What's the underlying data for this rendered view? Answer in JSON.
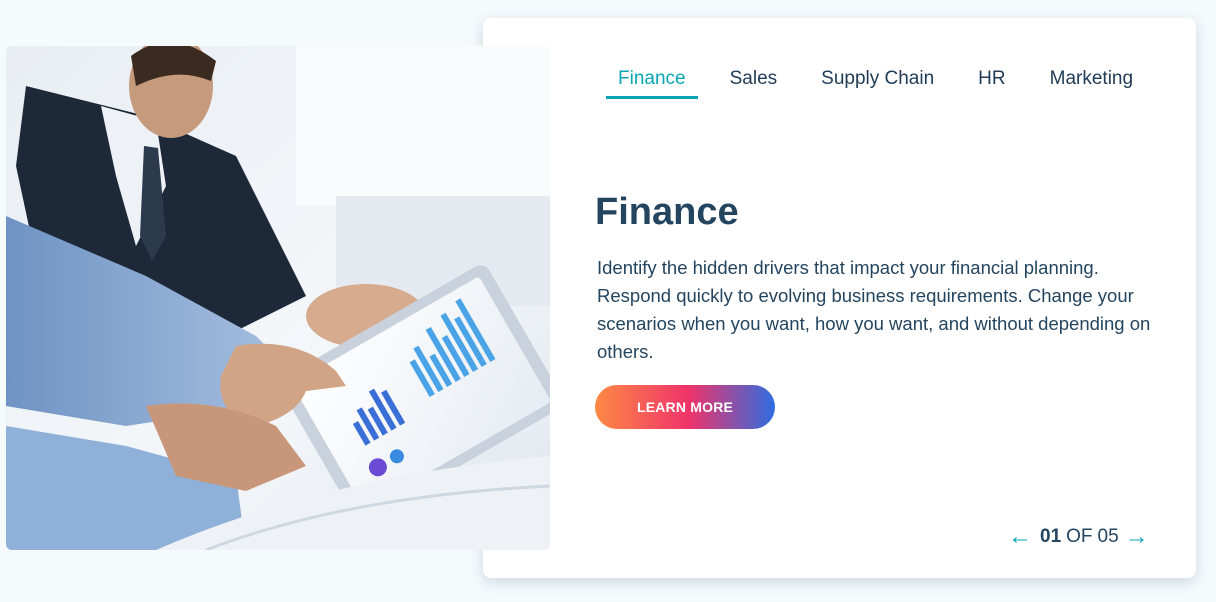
{
  "tabs": [
    {
      "label": "Finance",
      "active": true
    },
    {
      "label": "Sales",
      "active": false
    },
    {
      "label": "Supply Chain",
      "active": false
    },
    {
      "label": "HR",
      "active": false
    },
    {
      "label": "Marketing",
      "active": false
    }
  ],
  "content": {
    "title": "Finance",
    "description": "Identify the hidden drivers that impact your financial planning. Respond quickly to evolving business requirements. Change your scenarios when you want, how you want, and without depending on others.",
    "cta_label": "LEARN MORE"
  },
  "pager": {
    "current": "01",
    "of_label": "OF",
    "total": "05",
    "prev_icon": "arrow-left-icon",
    "next_icon": "arrow-right-icon"
  },
  "colors": {
    "accent": "#0aa5b4",
    "text": "#24455f",
    "cta_gradient": [
      "#fd8a44",
      "#f0336a",
      "#2e6de0"
    ]
  }
}
